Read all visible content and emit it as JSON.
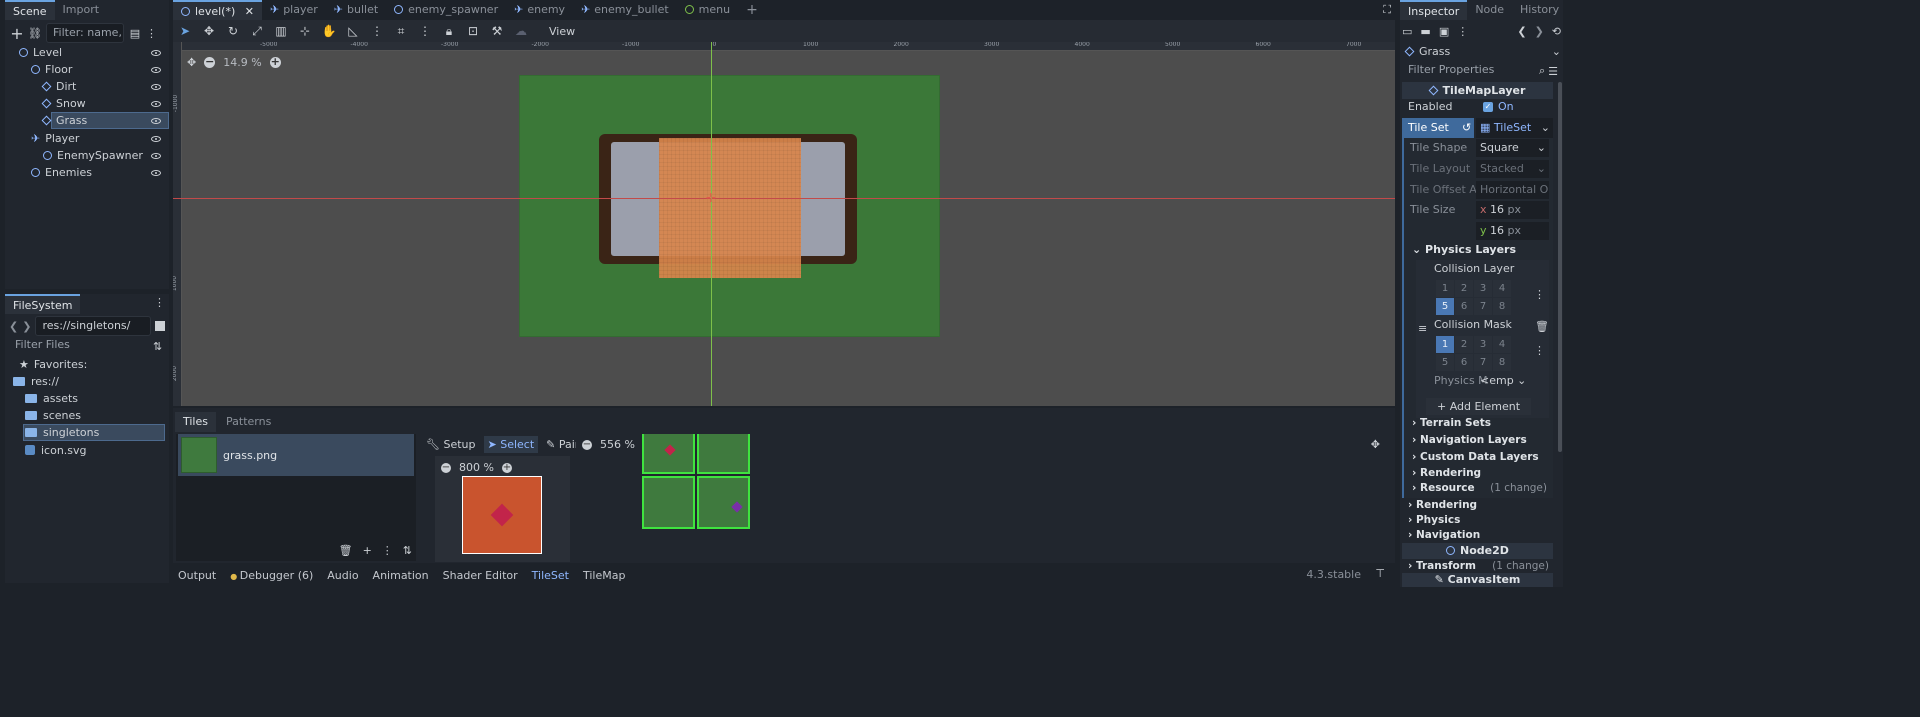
{
  "scene_dock": {
    "tabs": [
      "Scene",
      "Import"
    ],
    "filter_placeholder": "Filter: name, t:t",
    "nodes": [
      {
        "label": "Level",
        "depth": 0,
        "kind": "node"
      },
      {
        "label": "Floor",
        "depth": 1,
        "kind": "node"
      },
      {
        "label": "Dirt",
        "depth": 2,
        "kind": "tile"
      },
      {
        "label": "Snow",
        "depth": 2,
        "kind": "tile"
      },
      {
        "label": "Grass",
        "depth": 2,
        "kind": "tile",
        "selected": true
      },
      {
        "label": "Player",
        "depth": 1,
        "kind": "actor"
      },
      {
        "label": "EnemySpawner",
        "depth": 2,
        "kind": "node"
      },
      {
        "label": "Enemies",
        "depth": 1,
        "kind": "node"
      }
    ]
  },
  "filesystem": {
    "tab": "FileSystem",
    "path": "res://singletons/",
    "filter_placeholder": "Filter Files",
    "items": [
      {
        "label": "Favorites:",
        "kind": "star"
      },
      {
        "label": "res://",
        "kind": "folder"
      },
      {
        "label": "assets",
        "kind": "folder"
      },
      {
        "label": "scenes",
        "kind": "folder"
      },
      {
        "label": "singletons",
        "kind": "folder",
        "selected": true
      },
      {
        "label": "icon.svg",
        "kind": "file"
      }
    ]
  },
  "editor_tabs": [
    {
      "label": "level(*)",
      "active": true
    },
    {
      "label": "player"
    },
    {
      "label": "bullet"
    },
    {
      "label": "enemy_spawner"
    },
    {
      "label": "enemy"
    },
    {
      "label": "enemy_bullet"
    },
    {
      "label": "menu"
    }
  ],
  "toolbar": {
    "view_label": "View"
  },
  "viewport": {
    "zoom": "14.9 %",
    "ruler": [
      "-5000",
      "-4000",
      "-3000",
      "-2000",
      "-1000",
      "0",
      "1000",
      "2000",
      "3000",
      "4000",
      "5000",
      "6000",
      "7000"
    ],
    "ruler_v": [
      "-1000",
      "0",
      "1000",
      "2000"
    ]
  },
  "bottom_panel": {
    "tabs": [
      "Tiles",
      "Patterns"
    ],
    "source": "grass.png",
    "modes": [
      "Setup",
      "Select",
      "Paint"
    ],
    "atlas_zoom": "800 %",
    "tiles_zoom": "556 %"
  },
  "bottom_bar": {
    "tabs": [
      "Output",
      "Debugger (6)",
      "Audio",
      "Animation",
      "Shader Editor",
      "TileSet",
      "TileMap"
    ],
    "version": "4.3.stable"
  },
  "inspector": {
    "tabs": [
      "Inspector",
      "Node",
      "History"
    ],
    "node": "Grass",
    "filter_placeholder": "Filter Properties",
    "class": "TileMapLayer",
    "enabled_label": "Enabled",
    "enabled_value": "On",
    "tileset_label": "Tile Set",
    "tileset_value": "TileSet",
    "tile_shape_label": "Tile Shape",
    "tile_shape_value": "Square",
    "tile_layout_label": "Tile Layout",
    "tile_layout_value": "Stacked",
    "tile_offset_label": "Tile Offset Axis",
    "tile_offset_value": "Horizontal O",
    "tile_size_label": "Tile Size",
    "tile_size_x": "16",
    "tile_size_y": "16",
    "unit": "px",
    "physics_layers": "Physics Layers",
    "collision_layer": "Collision Layer",
    "collision_mask": "Collision Mask",
    "layer_numbers": [
      "1",
      "2",
      "3",
      "4",
      "5",
      "6",
      "7",
      "8"
    ],
    "physics_m": "Physics M",
    "physics_m_value": "<emp",
    "add_element": "Add Element",
    "sections": [
      "Terrain Sets",
      "Navigation Layers",
      "Custom Data Layers",
      "Rendering"
    ],
    "resource": "Resource",
    "resource_note": "(1 change)",
    "outer_sections": [
      "Rendering",
      "Physics",
      "Navigation"
    ],
    "node2d": "Node2D",
    "transform": "Transform",
    "transform_note": "(1 change)",
    "canvas_item": "CanvasItem"
  },
  "colors": {
    "accent": "#6aa3e0",
    "grass": "#3c7a3a",
    "orange": "#e0844a",
    "snow": "#9b9fac"
  }
}
